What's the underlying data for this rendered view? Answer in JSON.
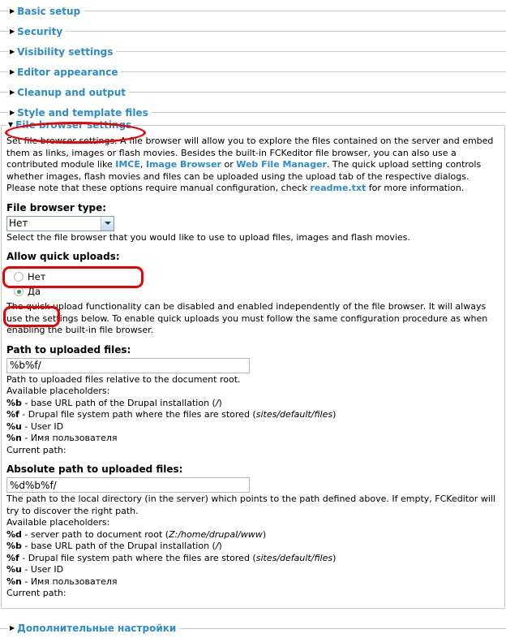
{
  "collapsed_fieldsets_top": [
    {
      "title": "Basic setup",
      "marker": "triangle-right-icon"
    },
    {
      "title": "Security",
      "marker": "triangle-right-icon"
    },
    {
      "title": "Visibility settings",
      "marker": "triangle-right-icon"
    },
    {
      "title": "Editor appearance",
      "marker": "triangle-right-icon"
    },
    {
      "title": "Cleanup and output",
      "marker": "triangle-right-icon"
    },
    {
      "title": "Style and template files",
      "marker": "triangle-right-icon"
    }
  ],
  "file_browser_fieldset": {
    "legend": "File browser settings",
    "marker": "triangle-down-icon",
    "description": {
      "part1": "Set file browser settings. A file browser will allow you to explore the files contained on the server and embed them as links, images or flash movies. Besides the built-in FCKeditor file browser, you can also use a contributed module like ",
      "link1": "IMCE",
      "sep1": ", ",
      "link2": "Image Browser",
      "sep2": " or ",
      "link3": "Web File Manager",
      "part2": ". The quick upload setting controls whether images, flash movies and files can be uploaded using the upload tab of the respective dialogs. Please note that these options require manual configuration, check ",
      "link4": "readme.txt",
      "part3": " for more information."
    },
    "file_browser_type": {
      "label": "File browser type:",
      "selected": "Нет",
      "options": [
        "Нет"
      ],
      "help": "Select the file browser that you would like to use to upload files, images and flash movies."
    },
    "allow_quick_uploads": {
      "label": "Allow quick uploads:",
      "options": [
        {
          "label": "Нет",
          "selected": false
        },
        {
          "label": "Да",
          "selected": true
        }
      ],
      "help": "The quick upload functionality can be disabled and enabled independently of the file browser. It will always use the settings below. To enable quick uploads you must follow the same configuration procedure as when enabling the built-in file browser."
    },
    "path_to_uploaded_files": {
      "label": "Path to uploaded files:",
      "value": "%b%f/",
      "help_line1": "Path to uploaded files relative to the document root.",
      "help_line2": "Available placeholders:",
      "placeholders": [
        {
          "code": "%b",
          "text": " - base URL path of the Drupal installation (",
          "example": "/",
          "tail": ")"
        },
        {
          "code": "%f",
          "text": " - Drupal file system path where the files are stored (",
          "example": "sites/default/files",
          "tail": ")"
        },
        {
          "code": "%u",
          "text": " - User ID",
          "example": "",
          "tail": ""
        },
        {
          "code": "%n",
          "text": " - Имя пользователя",
          "example": "",
          "tail": ""
        }
      ],
      "current_path": "Current path:"
    },
    "absolute_path_to_uploaded_files": {
      "label": "Absolute path to uploaded files:",
      "value": "%d%b%f/",
      "help_line1": "The path to the local directory (in the server) which points to the path defined above. If empty, FCKeditor will try to discover the right path.",
      "help_line2": "Available placeholders:",
      "placeholders": [
        {
          "code": "%d",
          "text": " - server path to document root (",
          "example": "Z:/home/drupal/www",
          "tail": ")"
        },
        {
          "code": "%b",
          "text": " - base URL path of the Drupal installation (",
          "example": "/",
          "tail": ")"
        },
        {
          "code": "%f",
          "text": " - Drupal file system path where the files are stored (",
          "example": "sites/default/files",
          "tail": ")"
        },
        {
          "code": "%u",
          "text": " - User ID",
          "example": "",
          "tail": ""
        },
        {
          "code": "%n",
          "text": " - Имя пользователя",
          "example": "",
          "tail": ""
        }
      ],
      "current_path": "Current path:"
    }
  },
  "collapsed_fieldsets_bottom": [
    {
      "title": "Дополнительные настройки",
      "marker": "triangle-right-icon"
    }
  ],
  "annotations": [
    {
      "name": "file-browser-settings-highlight",
      "shape": "ellipse"
    },
    {
      "name": "allow-quick-uploads-highlight",
      "shape": "rect"
    },
    {
      "name": "radio-yes-highlight",
      "shape": "rect"
    }
  ],
  "colors": {
    "link_blue": "#2b8ccc",
    "annotation_red": "#ee0000",
    "radio_selected_green": "#2f9e4f",
    "fieldset_border": "#cccccc"
  }
}
